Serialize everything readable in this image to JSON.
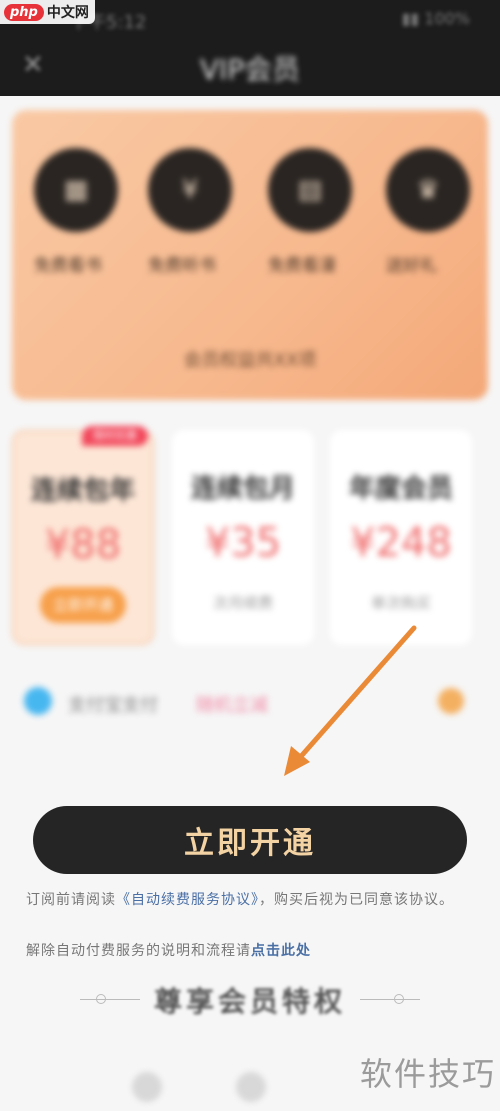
{
  "status_bar": {
    "time": "下午5:12",
    "signal": "▮▮ 100%"
  },
  "watermark_top": {
    "brand": "php",
    "text": "中文网"
  },
  "header": {
    "back_icon": "close-icon",
    "title": "VIP会员"
  },
  "benefits": {
    "items": [
      {
        "icon": "book-icon",
        "glyph": "▦",
        "label": "免费看书"
      },
      {
        "icon": "coin-icon",
        "glyph": "¥",
        "label": "免费听书"
      },
      {
        "icon": "grid-icon",
        "glyph": "▤",
        "label": "免费看漫"
      },
      {
        "icon": "gift-icon",
        "glyph": "♛",
        "label": "送好礼"
      }
    ],
    "note": "会员权益共XX项"
  },
  "plans": [
    {
      "name": "连续包年",
      "price": "¥88",
      "sub": "立即开通",
      "tag": "限时优惠",
      "selected": true
    },
    {
      "name": "连续包月",
      "price": "¥35",
      "sub": "次月续费",
      "selected": false
    },
    {
      "name": "年度会员",
      "price": "¥248",
      "sub": "单次购买",
      "selected": false
    }
  ],
  "payment": {
    "method": "支付宝支付",
    "promo": "随机立减"
  },
  "cta": {
    "label": "立即开通"
  },
  "agreement": {
    "prefix": "订阅前请阅读",
    "link": "《自动续费服务协议》",
    "suffix": "，购买后视为已同意该协议。"
  },
  "cancel_info": {
    "prefix": "解除自动付费服务的说明和流程请",
    "link": "点击此处"
  },
  "privilege_heading": "尊享会员特权",
  "watermark_bottom": "软件技巧",
  "colors": {
    "accent": "#f7a04b",
    "price": "#f06a6a",
    "button_bg": "#252525",
    "button_text": "#f3d2a3",
    "link": "#4a6fa5",
    "arrow": "#ea8a37"
  }
}
